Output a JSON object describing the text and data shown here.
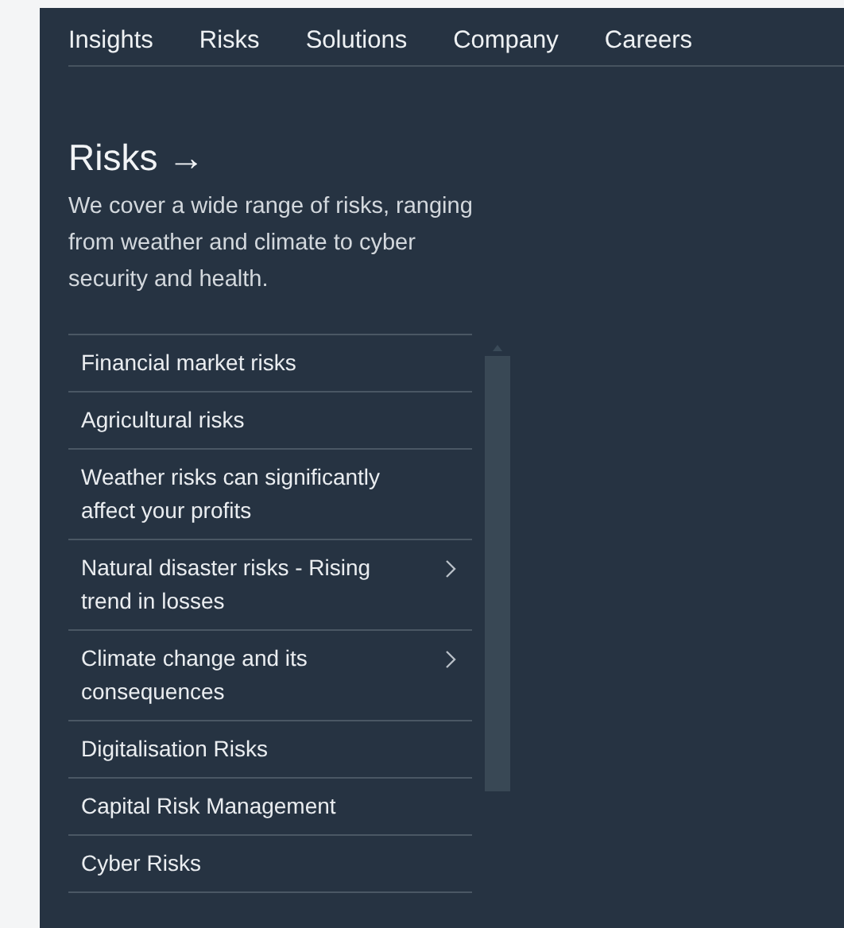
{
  "nav": {
    "items": [
      {
        "label": "Insights"
      },
      {
        "label": "Risks"
      },
      {
        "label": "Solutions"
      },
      {
        "label": "Company"
      },
      {
        "label": "Careers"
      }
    ]
  },
  "section": {
    "title": "Risks →",
    "description": "We cover a wide range of risks, ranging from weather and climate to cyber security and health."
  },
  "menu": {
    "items": [
      {
        "label": "Financial market risks",
        "kind": "link"
      },
      {
        "label": "Agricultural risks",
        "kind": "link"
      },
      {
        "label": "Weather risks can significantly affect your profits",
        "kind": "link"
      },
      {
        "label": "Natural disaster risks - Rising trend in losses",
        "kind": "submenu"
      },
      {
        "label": "Climate change and its consequences",
        "kind": "submenu"
      },
      {
        "label": "Digitalisation Risks",
        "kind": "link"
      },
      {
        "label": "Capital Risk Management",
        "kind": "link"
      },
      {
        "label": "Cyber Risks",
        "kind": "link"
      }
    ]
  }
}
